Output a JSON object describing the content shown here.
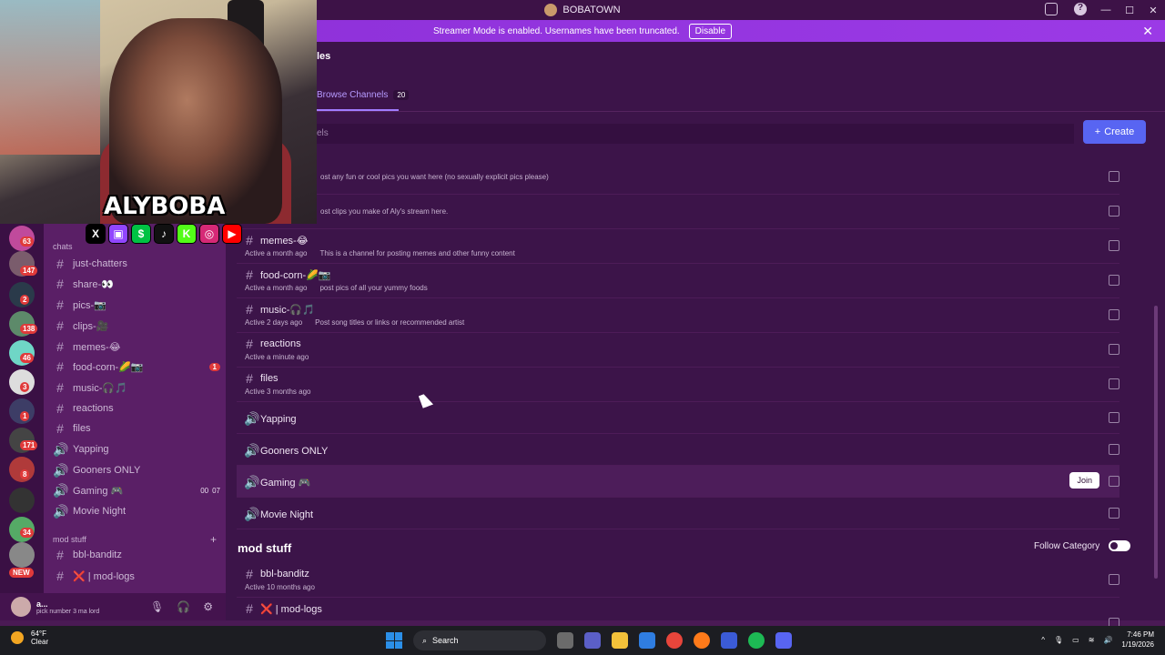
{
  "window": {
    "title": "BOBATOWN"
  },
  "banner": {
    "text": "Streamer Mode is enabled. Usernames have been truncated.",
    "disable_label": "Disable",
    "close_glyph": "✕"
  },
  "webcam": {
    "overlay_name": "ALYBOBA",
    "socials": [
      {
        "icon": "x-icon",
        "glyph": "X",
        "color": "#000000"
      },
      {
        "icon": "twitch-icon",
        "glyph": "▣",
        "color": "#9146ff"
      },
      {
        "icon": "cashapp-icon",
        "glyph": "$",
        "color": "#00c244"
      },
      {
        "icon": "tiktok-icon",
        "glyph": "♪",
        "color": "#111111"
      },
      {
        "icon": "kick-icon",
        "glyph": "K",
        "color": "#53fc18"
      },
      {
        "icon": "instagram-icon",
        "glyph": "◎",
        "color": "#d62976"
      },
      {
        "icon": "youtube-icon",
        "glyph": "▶",
        "color": "#ff0000"
      }
    ]
  },
  "server_rail": {
    "badges": [
      "63",
      "147",
      "2",
      "138",
      "46",
      "3",
      "1",
      "171",
      "8",
      "34",
      "NEW"
    ]
  },
  "sidebar": {
    "category_chats": "chats",
    "category_mod": "mod stuff",
    "channels": [
      {
        "glyph": "#",
        "label": "just-chatters"
      },
      {
        "glyph": "#",
        "label": "share-👀"
      },
      {
        "glyph": "#",
        "label": "pics-📷"
      },
      {
        "glyph": "#",
        "label": "clips-🎥"
      },
      {
        "glyph": "#",
        "label": "memes-😂"
      },
      {
        "glyph": "#",
        "label": "food-corn-🌽📷",
        "badge": "1"
      },
      {
        "glyph": "#",
        "label": "music-🎧🎵"
      },
      {
        "glyph": "#",
        "label": "reactions"
      },
      {
        "glyph": "#",
        "label": "files"
      },
      {
        "glyph": "🔊",
        "label": "Yapping"
      },
      {
        "glyph": "🔊",
        "label": "Gooners ONLY"
      },
      {
        "glyph": "🔊",
        "label": "Gaming 🎮",
        "timer_a": "00",
        "timer_b": "07"
      },
      {
        "glyph": "🔊",
        "label": "Movie Night"
      }
    ],
    "mod_channels": [
      {
        "glyph": "#",
        "label": "bbl-banditz"
      },
      {
        "glyph": "#",
        "label": "❌ | mod-logs"
      }
    ]
  },
  "user_panel": {
    "name": "a...",
    "status": "pick number 3 ma lord"
  },
  "main": {
    "header_fragment": "les",
    "tab_label": "Browse Channels",
    "tab_count": "20",
    "search_placeholder": "els",
    "create_label": "Create",
    "rows": [
      {
        "type": "text",
        "name": "",
        "active": "",
        "desc": "ost any fun or cool pics you want here (no sexually explicit pics please)"
      },
      {
        "type": "text",
        "name": "",
        "active": "",
        "desc": "ost clips you make of Aly's stream here."
      },
      {
        "type": "text",
        "name": "memes-😂",
        "active": "Active a month ago",
        "desc": "This is a channel for posting memes and other funny content"
      },
      {
        "type": "text",
        "name": "food-corn-🌽📷",
        "active": "Active a month ago",
        "desc": "post pics of all your yummy foods"
      },
      {
        "type": "text",
        "name": "music-🎧🎵",
        "active": "Active 2 days ago",
        "desc": "Post song titles or links or recommended artist"
      },
      {
        "type": "text",
        "name": "reactions",
        "active": "Active a minute ago",
        "desc": ""
      },
      {
        "type": "text",
        "name": "files",
        "active": "Active 3 months ago",
        "desc": ""
      },
      {
        "type": "voice",
        "name": "Yapping"
      },
      {
        "type": "voice",
        "name": "Gooners ONLY"
      },
      {
        "type": "voice",
        "name": "Gaming 🎮",
        "join_label": "Join"
      },
      {
        "type": "voice",
        "name": "Movie Night"
      }
    ],
    "mod_category": "mod stuff",
    "follow_label": "Follow Category",
    "mod_rows": [
      {
        "type": "text",
        "name": "bbl-banditz",
        "active": "Active 10 months ago",
        "desc": ""
      },
      {
        "type": "text",
        "name": "❌ | mod-logs",
        "active": "",
        "desc": ""
      }
    ]
  },
  "taskbar": {
    "weather_temp": "64°F",
    "weather_desc": "Clear",
    "search_label": "Search",
    "time": "7:46 PM",
    "date": "1/19/2026"
  }
}
